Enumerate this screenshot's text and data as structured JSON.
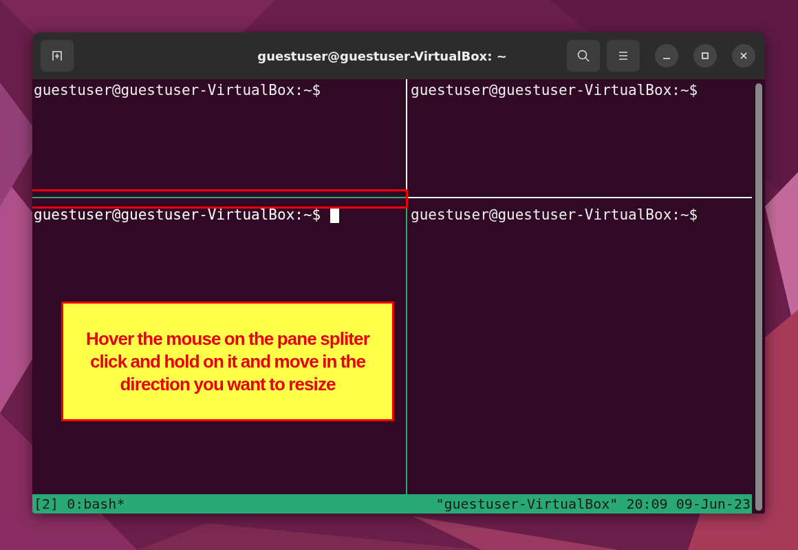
{
  "window": {
    "title": "guestuser@guestuser-VirtualBox: ~"
  },
  "panes": [
    {
      "prompt": "guestuser@guestuser-VirtualBox:~$",
      "selected": false
    },
    {
      "prompt": "guestuser@guestuser-VirtualBox:~$",
      "selected": false
    },
    {
      "prompt": "guestuser@guestuser-VirtualBox:~$",
      "selected": true
    },
    {
      "prompt": "guestuser@guestuser-VirtualBox:~$",
      "selected": false
    }
  ],
  "status_bar": {
    "left": "[2] 0:bash*",
    "right": "\"guestuser-VirtualBox\" 20:09 09-Jun-23"
  },
  "annotation": {
    "text": "Hover the mouse on the pane spliter click and hold on it and move in the direction you want to resize"
  }
}
